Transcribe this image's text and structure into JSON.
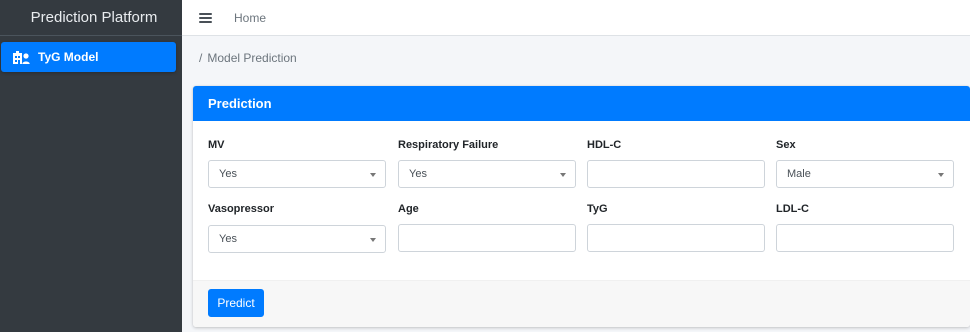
{
  "sidebar": {
    "brand": "Prediction Platform",
    "items": [
      {
        "label": "TyG Model",
        "icon": "hospital-user-icon",
        "active": true
      }
    ]
  },
  "topbar": {
    "menu_icon": "hamburger-menu-icon",
    "home_link": "Home"
  },
  "breadcrumb": {
    "separator": "/",
    "current": "Model Prediction"
  },
  "card": {
    "title": "Prediction",
    "accent_color": "#007bff",
    "fields": {
      "mv": {
        "label": "MV",
        "type": "select",
        "value": "Yes"
      },
      "respiratory_failure": {
        "label": "Respiratory Failure",
        "type": "select",
        "value": "Yes"
      },
      "hdl_c": {
        "label": "HDL-C",
        "type": "input",
        "value": ""
      },
      "sex": {
        "label": "Sex",
        "type": "select",
        "value": "Male"
      },
      "vasopressor": {
        "label": "Vasopressor",
        "type": "select",
        "value": "Yes"
      },
      "age": {
        "label": "Age",
        "type": "input",
        "value": ""
      },
      "tyg": {
        "label": "TyG",
        "type": "input",
        "value": ""
      },
      "ldl_c": {
        "label": "LDL-C",
        "type": "input",
        "value": ""
      }
    },
    "submit_label": "Predict"
  }
}
